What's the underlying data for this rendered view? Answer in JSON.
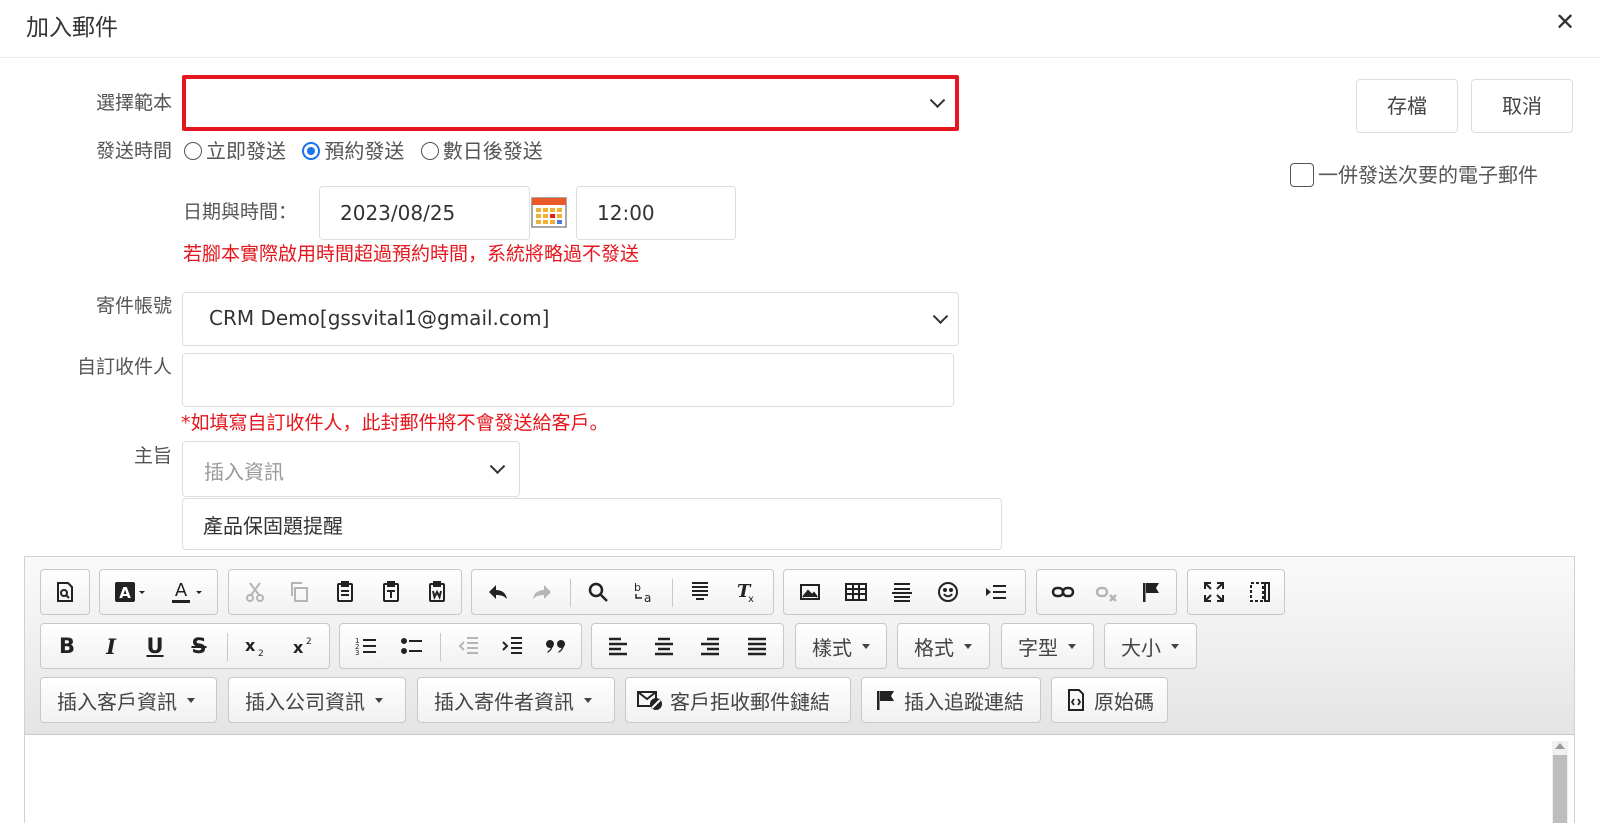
{
  "header": {
    "title": "加入郵件",
    "close": "✕"
  },
  "form": {
    "template_label": "選擇範本",
    "template_value": "",
    "send_time_label": "發送時間",
    "send_options": [
      "立即發送",
      "預約發送",
      "數日後發送"
    ],
    "send_selected": "預約發送",
    "date_time_label": "日期與時間：",
    "date_value": "2023/08/25",
    "time_value": "12:00",
    "schedule_warning": "若腳本實際啟用時間超過預約時間，系統將略過不發送",
    "sender_label": "寄件帳號",
    "sender_value": "CRM Demo[gssvital1@gmail.com]",
    "recipient_label": "自訂收件人",
    "recipient_value": "",
    "recipient_warning": "*如填寫自訂收件人，此封郵件將不會發送給客戶。",
    "subject_label": "主旨",
    "insert_info_placeholder": "插入資訊",
    "subject_value": "產品保固題提醒"
  },
  "actions": {
    "save": "存檔",
    "cancel": "取消",
    "also_send_label": "一併發送次要的電子郵件"
  },
  "toolbar": {
    "styles": "樣式",
    "format": "格式",
    "font": "字型",
    "size": "大小",
    "insert_customer": "插入客戶資訊",
    "insert_company": "插入公司資訊",
    "insert_sender": "插入寄件者資訊",
    "unsubscribe_link": "客戶拒收郵件鏈結",
    "tracking_link": "插入追蹤連結",
    "source": "原始碼",
    "bold": "B",
    "italic": "I",
    "underline": "U",
    "strike": "S"
  },
  "colors": {
    "accent": "#1a73e8",
    "warning": "#e5161d"
  }
}
